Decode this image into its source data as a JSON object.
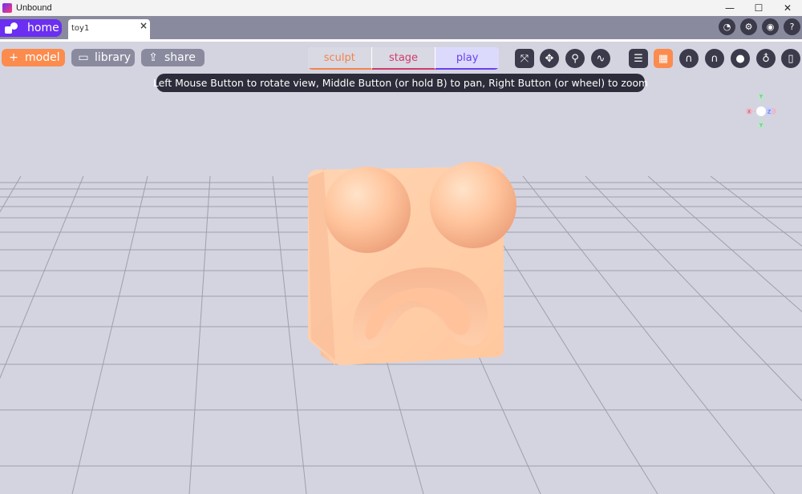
{
  "window": {
    "title": "Unbound",
    "controls": {
      "minimize": "—",
      "maximize": "☐",
      "close": "✕"
    }
  },
  "tabs": {
    "home_label": "home",
    "document_tab": {
      "label": "toy1",
      "close_glyph": "×"
    }
  },
  "header_icons": [
    {
      "name": "performance-gauge-icon",
      "glyph": "◔"
    },
    {
      "name": "settings-gear-icon",
      "glyph": "⚙"
    },
    {
      "name": "discord-icon",
      "glyph": "◉"
    },
    {
      "name": "help-icon",
      "glyph": "?"
    }
  ],
  "toolbar": {
    "model_label": "model",
    "model_glyph": "+",
    "library_label": "library",
    "library_glyph": "▭",
    "share_label": "share",
    "share_glyph": "⇪"
  },
  "modes": {
    "sculpt": "sculpt",
    "stage": "stage",
    "play": "play",
    "active": "play"
  },
  "tools": [
    {
      "name": "axes-gizmo-icon",
      "glyph": "⤧",
      "active": false
    },
    {
      "name": "move-icon",
      "glyph": "✥",
      "active": false
    },
    {
      "name": "pin-icon",
      "glyph": "⚲",
      "active": false
    },
    {
      "name": "curve-icon",
      "glyph": "∿",
      "active": false
    },
    {
      "name": "list-icon",
      "glyph": "☰",
      "active": false
    },
    {
      "name": "grid-icon",
      "glyph": "▦",
      "active": true
    },
    {
      "name": "magnet-icon",
      "glyph": "∩",
      "active": false
    },
    {
      "name": "snap-magnet-icon",
      "glyph": "∩",
      "active": false
    },
    {
      "name": "material-icon",
      "glyph": "●",
      "active": false
    },
    {
      "name": "light-bulb-icon",
      "glyph": "♁",
      "active": false
    },
    {
      "name": "bookmark-icon",
      "glyph": "▯",
      "active": false
    }
  ],
  "hint": "Left Mouse Button to rotate view, Middle Button (or hold B) to pan, Right Button (or wheel) to zoom",
  "gizmo": {
    "y_top": "Y",
    "x_left": "X",
    "z_center": "Z",
    "y_bottom": "Y"
  },
  "colors": {
    "accent_orange": "#fb8c4e",
    "accent_purple": "#6a2ff0",
    "accent_pink": "#d03c6a",
    "background": "#d4d4e1",
    "toy_skin": "#ffcfa8"
  }
}
